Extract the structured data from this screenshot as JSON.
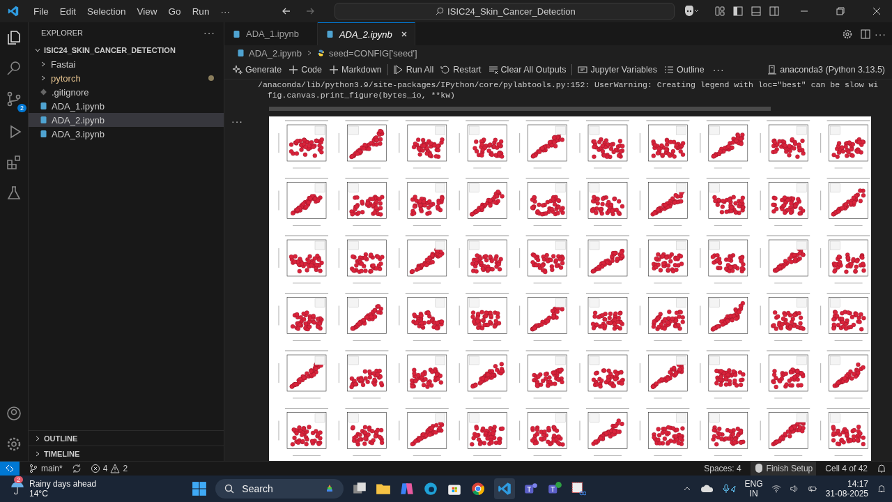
{
  "menu": [
    "File",
    "Edit",
    "Selection",
    "View",
    "Go",
    "Run",
    "···"
  ],
  "command_center": "ISIC24_Skin_Cancer_Detection",
  "activity_bar": {
    "source_control_badge": "2"
  },
  "explorer": {
    "title": "EXPLORER",
    "more": "···",
    "root": "ISIC24_SKIN_CANCER_DETECTION",
    "expanded": true,
    "items": [
      {
        "name": "Fastai",
        "kind": "folder",
        "modified": false,
        "selected": false
      },
      {
        "name": "pytorch",
        "kind": "folder",
        "modified": true,
        "selected": false
      },
      {
        "name": ".gitignore",
        "kind": "git",
        "modified": false,
        "selected": false
      },
      {
        "name": "ADA_1.ipynb",
        "kind": "notebook",
        "modified": false,
        "selected": false
      },
      {
        "name": "ADA_2.ipynb",
        "kind": "notebook",
        "modified": false,
        "selected": true
      },
      {
        "name": "ADA_3.ipynb",
        "kind": "notebook",
        "modified": false,
        "selected": false
      }
    ],
    "panels": [
      "OUTLINE",
      "TIMELINE"
    ]
  },
  "tabs": [
    {
      "label": "ADA_1.ipynb",
      "selected": false,
      "preview": false
    },
    {
      "label": "ADA_2.ipynb",
      "selected": true,
      "preview": true
    }
  ],
  "editor_more": "···",
  "breadcrumb": [
    "ADA_2.ipynb",
    "seed=CONFIG['seed']"
  ],
  "toolbar": [
    "Generate",
    "Code",
    "Markdown",
    "Run All",
    "Restart",
    "Clear All Outputs",
    "Jupyter Variables",
    "Outline"
  ],
  "toolbar_more": "···",
  "cell_more": "···",
  "kernel": "anaconda3 (Python 3.13.5)",
  "output_lines": [
    "/anaconda/lib/python3.9/site-packages/IPython/core/pylabtools.py:152: UserWarning: Creating legend with loc=\"best\" can be slow wi",
    "  fig.canvas.print_figure(bytes_io, **kw)"
  ],
  "status_bar": {
    "branch": "main*",
    "errors": "4",
    "warnings": "2",
    "right": [
      "Spaces: 4",
      "Finish Setup",
      "Cell 4 of 42"
    ]
  },
  "taskbar": {
    "weather": "Rainy days ahead",
    "temperature": "14°C",
    "weather_badge": "2",
    "search": "Search",
    "language": "ENG",
    "region": "IN",
    "time": "14:17",
    "date": "31-08-2025"
  }
}
